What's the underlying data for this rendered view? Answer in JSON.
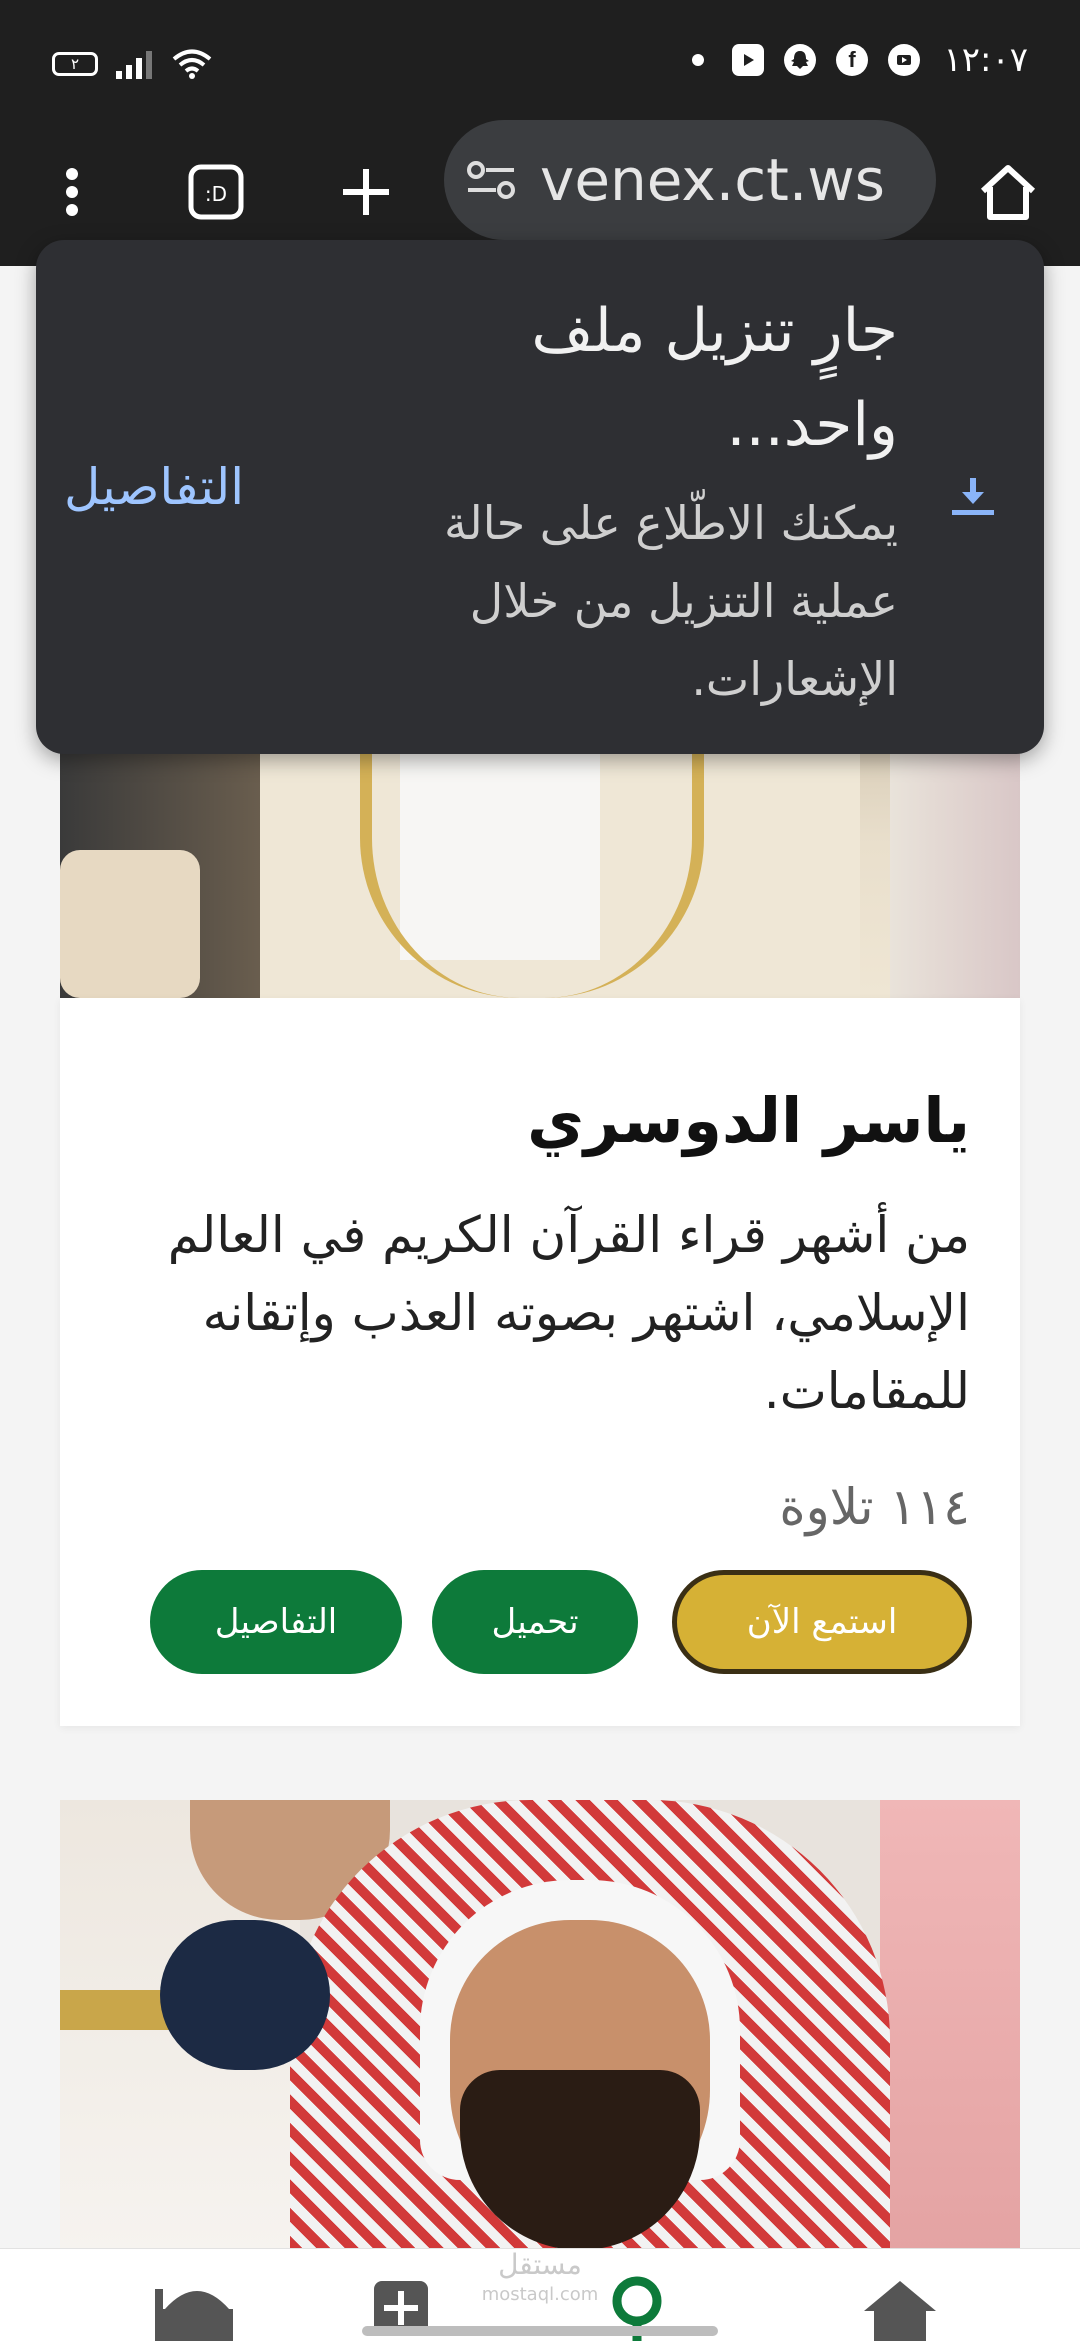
{
  "status_bar": {
    "time": "١٢:٠٧",
    "battery_level": "٢"
  },
  "browser": {
    "url": "venex.ct.ws"
  },
  "download_snackbar": {
    "title": "جارٍ تنزيل ملف واحد...",
    "message": "يمكنك الاطّلاع على حالة عملية التنزيل من خلال الإشعارات.",
    "action_label": "التفاصيل"
  },
  "reciter": {
    "name": "ياسر الدوسري",
    "description": "من أشهر قراء القرآن الكريم في العالم الإسلامي، اشتهر بصوته العذب وإتقانه للمقامات.",
    "recitation_count": "١١٤ تلاوة",
    "listen_label": "استمع الآن",
    "download_label": "تحميل",
    "details_label": "التفاصيل"
  },
  "watermark": {
    "brand": "مستقل",
    "domain": "mostaql.com"
  },
  "colors": {
    "primary_green": "#0d7a3a",
    "accent_gold": "#d6b135",
    "snackbar_bg": "#2e2f33",
    "link_blue": "#9ec5ff"
  }
}
